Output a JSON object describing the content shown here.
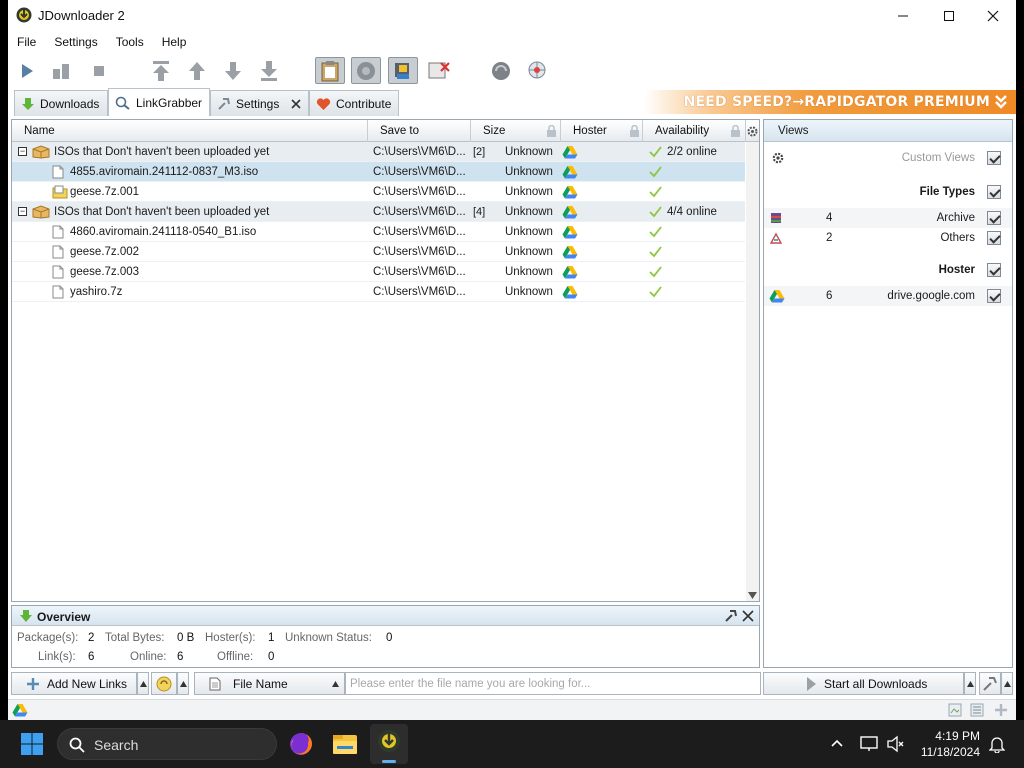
{
  "window": {
    "title": "JDownloader 2"
  },
  "menu": [
    "File",
    "Settings",
    "Tools",
    "Help"
  ],
  "tabs": [
    {
      "label": "Downloads"
    },
    {
      "label": "LinkGrabber"
    },
    {
      "label": "Settings"
    },
    {
      "label": "Contribute"
    }
  ],
  "promo": "NEED SPEED?→RAPIDGATOR PREMIUM",
  "grid": {
    "columns": [
      "Name",
      "Save to",
      "Size",
      "Hoster",
      "Availability"
    ],
    "rows": [
      {
        "kind": "package",
        "name": "ISOs that Don't haven't been uploaded yet",
        "save_to": "C:\\Users\\VM6\\D...",
        "count": "[2]",
        "size": "Unknown",
        "availability": "2/2 online"
      },
      {
        "kind": "file",
        "name": "4855.aviromain.241112-0837_M3.iso",
        "save_to": "C:\\Users\\VM6\\D...",
        "count": "",
        "size": "Unknown",
        "availability": ""
      },
      {
        "kind": "file",
        "name": "geese.7z.001",
        "save_to": "C:\\Users\\VM6\\D...",
        "count": "",
        "size": "Unknown",
        "availability": ""
      },
      {
        "kind": "package",
        "name": "ISOs that Don't haven't been uploaded yet",
        "save_to": "C:\\Users\\VM6\\D...",
        "count": "[4]",
        "size": "Unknown",
        "availability": "4/4 online"
      },
      {
        "kind": "file",
        "name": "4860.aviromain.241118-0540_B1.iso",
        "save_to": "C:\\Users\\VM6\\D...",
        "count": "",
        "size": "Unknown",
        "availability": ""
      },
      {
        "kind": "file",
        "name": "geese.7z.002",
        "save_to": "C:\\Users\\VM6\\D...",
        "count": "",
        "size": "Unknown",
        "availability": ""
      },
      {
        "kind": "file",
        "name": "geese.7z.003",
        "save_to": "C:\\Users\\VM6\\D...",
        "count": "",
        "size": "Unknown",
        "availability": ""
      },
      {
        "kind": "file",
        "name": "yashiro.7z",
        "save_to": "C:\\Users\\VM6\\D...",
        "count": "",
        "size": "Unknown",
        "availability": ""
      }
    ]
  },
  "overview": {
    "title": "Overview",
    "packages_label": "Package(s):",
    "packages": "2",
    "bytes_label": "Total Bytes:",
    "bytes": "0 B",
    "hosters_label": "Hoster(s):",
    "hosters": "1",
    "unknown_label": "Unknown Status:",
    "unknown": "0",
    "links_label": "Link(s):",
    "links": "6",
    "online_label": "Online:",
    "online": "6",
    "offline_label": "Offline:",
    "offline": "0"
  },
  "views": {
    "title": "Views",
    "custom_views": "Custom Views",
    "file_types": "File Types",
    "archive_count": "4",
    "archive_label": "Archive",
    "others_count": "2",
    "others_label": "Others",
    "hoster_title": "Hoster",
    "hoster_count": "6",
    "hoster_label": "drive.google.com"
  },
  "bottombar": {
    "add_links": "Add New Links",
    "filter_field": "File Name",
    "search_placeholder": "Please enter the file name you are looking for...",
    "start_all": "Start all Downloads"
  },
  "taskbar": {
    "search": "Search",
    "time": "4:19 PM",
    "date": "11/18/2024"
  },
  "colors": {
    "accent": "#ef8a26",
    "selection": "#cfe2ef",
    "package_row": "#e8edf1"
  }
}
